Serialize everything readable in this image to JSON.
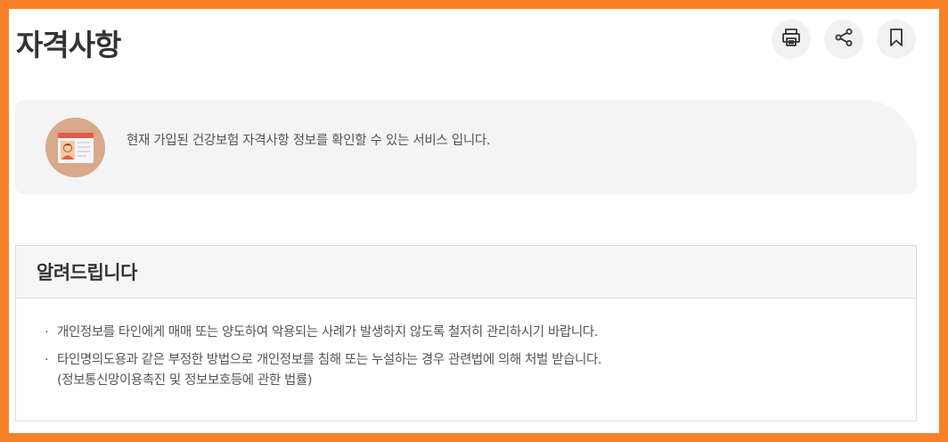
{
  "page": {
    "title": "자격사항"
  },
  "actions": {
    "print": "print-icon",
    "share": "share-icon",
    "bookmark": "bookmark-icon"
  },
  "intro": {
    "text": "현재 가입된 건강보험 자격사항 정보를 확인할 수 있는 서비스 입니다."
  },
  "notice": {
    "title": "알려드립니다",
    "items": [
      {
        "text": "개인정보를 타인에게 매매 또는 양도하여 악용되는 사례가 발생하지 않도록 철저히 관리하시기 바랍니다."
      },
      {
        "text": "타인명의도용과 같은 부정한 방법으로 개인정보를 침해 또는 누설하는 경우 관련법에 의해 처벌 받습니다.",
        "sub": "(정보통신망이용촉진 및 정보보호등에 관한 법률)"
      }
    ],
    "bullet": "·"
  },
  "colors": {
    "frame": "#fa8128",
    "avatar_bg": "#d8a98a",
    "card_header": "#e05a4f"
  }
}
